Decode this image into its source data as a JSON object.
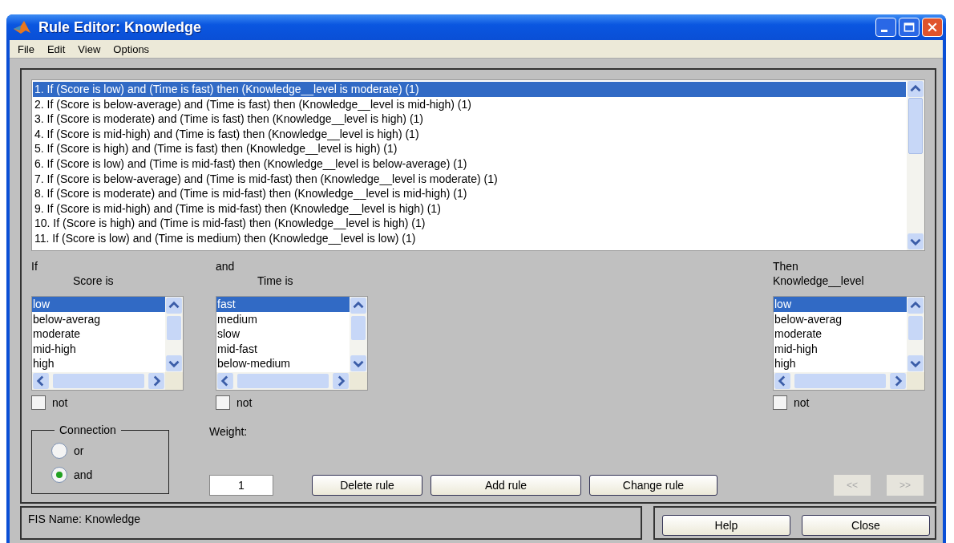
{
  "window": {
    "title": "Rule Editor: Knowledge"
  },
  "menu": [
    "File",
    "Edit",
    "View",
    "Options"
  ],
  "rules": [
    {
      "text": "1. If (Score is low) and (Time is fast) then (Knowledge__level is moderate) (1)",
      "selected": true
    },
    {
      "text": "2. If (Score is below-average) and (Time is fast) then (Knowledge__level is mid-high) (1)",
      "selected": false
    },
    {
      "text": "3. If (Score is moderate) and (Time is fast) then (Knowledge__level is high) (1)",
      "selected": false
    },
    {
      "text": "4. If (Score is mid-high) and (Time is fast) then (Knowledge__level is high) (1)",
      "selected": false
    },
    {
      "text": "5. If (Score is high) and (Time is fast) then (Knowledge__level is high) (1)",
      "selected": false
    },
    {
      "text": "6. If (Score is low) and (Time is mid-fast) then (Knowledge__level is below-average) (1)",
      "selected": false
    },
    {
      "text": "7. If (Score is below-average) and (Time is mid-fast) then (Knowledge__level is moderate) (1)",
      "selected": false
    },
    {
      "text": "8. If (Score is moderate) and (Time is mid-fast) then (Knowledge__level is mid-high) (1)",
      "selected": false
    },
    {
      "text": "9. If (Score is mid-high) and (Time is mid-fast) then (Knowledge__level is high) (1)",
      "selected": false
    },
    {
      "text": "10. If (Score is high) and (Time is mid-fast) then (Knowledge__level is high) (1)",
      "selected": false
    },
    {
      "text": "11. If (Score is low) and (Time is medium) then (Knowledge__level is low) (1)",
      "selected": false
    }
  ],
  "variables": [
    {
      "kind": "input",
      "connective": "If",
      "label": "Score is",
      "options": [
        {
          "text": "low",
          "selected": true
        },
        {
          "text": "below-averag",
          "selected": false
        },
        {
          "text": "moderate",
          "selected": false
        },
        {
          "text": "mid-high",
          "selected": false
        },
        {
          "text": "high",
          "selected": false
        }
      ],
      "not": {
        "label": "not",
        "checked": false
      }
    },
    {
      "kind": "input",
      "connective": "and",
      "label": "Time is",
      "options": [
        {
          "text": "fast",
          "selected": true
        },
        {
          "text": "medium",
          "selected": false
        },
        {
          "text": "slow",
          "selected": false
        },
        {
          "text": "mid-fast",
          "selected": false
        },
        {
          "text": "below-medium",
          "selected": false
        }
      ],
      "not": {
        "label": "not",
        "checked": false
      }
    },
    {
      "kind": "output",
      "connective": "Then",
      "label": "Knowledge__level",
      "options": [
        {
          "text": "low",
          "selected": true
        },
        {
          "text": "below-averag",
          "selected": false
        },
        {
          "text": "moderate",
          "selected": false
        },
        {
          "text": "mid-high",
          "selected": false
        },
        {
          "text": "high",
          "selected": false
        }
      ],
      "not": {
        "label": "not",
        "checked": false
      }
    }
  ],
  "connection": {
    "title": "Connection",
    "options": [
      {
        "label": "or",
        "selected": false
      },
      {
        "label": "and",
        "selected": true
      }
    ]
  },
  "weight": {
    "label": "Weight:",
    "value": "1"
  },
  "buttons": [
    {
      "label": "Delete rule",
      "disabled": false
    },
    {
      "label": "Add rule",
      "disabled": false
    },
    {
      "label": "Change rule",
      "disabled": false
    }
  ],
  "nav": [
    {
      "label": "<<",
      "disabled": true
    },
    {
      "label": ">>",
      "disabled": true
    }
  ],
  "status": "FIS Name: Knowledge",
  "footer_buttons": [
    "Help",
    "Close"
  ]
}
